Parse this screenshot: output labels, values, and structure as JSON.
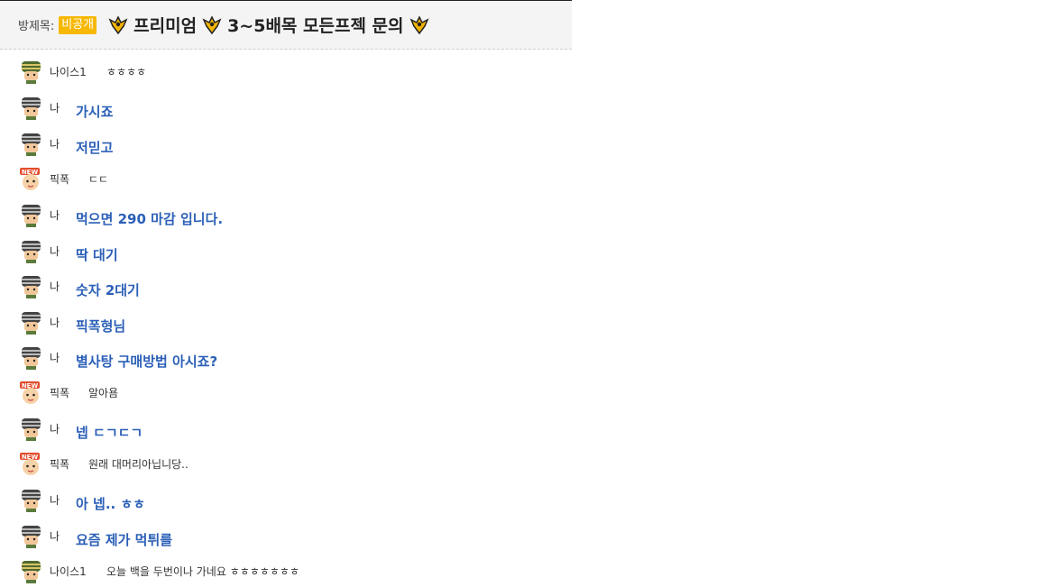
{
  "header": {
    "room_label": "방제목:",
    "badge": "비공개",
    "title": "프리미엄",
    "title2": "3~5배목 모든프젝 문의"
  },
  "colors": {
    "accent_blue": "#2b5fb7",
    "badge": "#f6b800"
  },
  "messages": [
    {
      "avatar": "helmet-green-icon",
      "name": "나이스1",
      "text": "ㅎㅎㅎㅎ",
      "mine": false
    },
    {
      "avatar": "helmet-gray-icon",
      "name": "나",
      "text": "가시죠",
      "mine": true
    },
    {
      "avatar": "helmet-gray-icon",
      "name": "나",
      "text": "저믿고",
      "mine": true
    },
    {
      "avatar": "new-face-icon",
      "name": "픽폭",
      "text": "ㄷㄷ",
      "mine": false
    },
    {
      "avatar": "helmet-gray-icon",
      "name": "나",
      "text": "먹으면 290 마감 입니다.",
      "mine": true
    },
    {
      "avatar": "helmet-gray-icon",
      "name": "나",
      "text": "딱 대기",
      "mine": true
    },
    {
      "avatar": "helmet-gray-icon",
      "name": "나",
      "text": "숫자 2대기",
      "mine": true
    },
    {
      "avatar": "helmet-gray-icon",
      "name": "나",
      "text": "픽폭형님",
      "mine": true
    },
    {
      "avatar": "helmet-gray-icon",
      "name": "나",
      "text": "별사탕 구매방법 아시죠?",
      "mine": true
    },
    {
      "avatar": "new-face-icon",
      "name": "픽폭",
      "text": "알아욤",
      "mine": false
    },
    {
      "avatar": "helmet-gray-icon",
      "name": "나",
      "text": "넵 ㄷㄱㄷㄱ",
      "mine": true
    },
    {
      "avatar": "new-face-icon",
      "name": "픽폭",
      "text": "원래 대머리아닙니당..",
      "mine": false
    },
    {
      "avatar": "helmet-gray-icon",
      "name": "나",
      "text": "아 넵.. ㅎㅎ",
      "mine": true
    },
    {
      "avatar": "helmet-gray-icon",
      "name": "나",
      "text": "요즘 제가 먹튀를",
      "mine": true
    },
    {
      "avatar": "helmet-green-icon",
      "name": "나이스1",
      "text": "오늘 백을 두번이나 가네요 ㅎㅎㅎㅎㅎㅎㅎ",
      "mine": false
    }
  ]
}
